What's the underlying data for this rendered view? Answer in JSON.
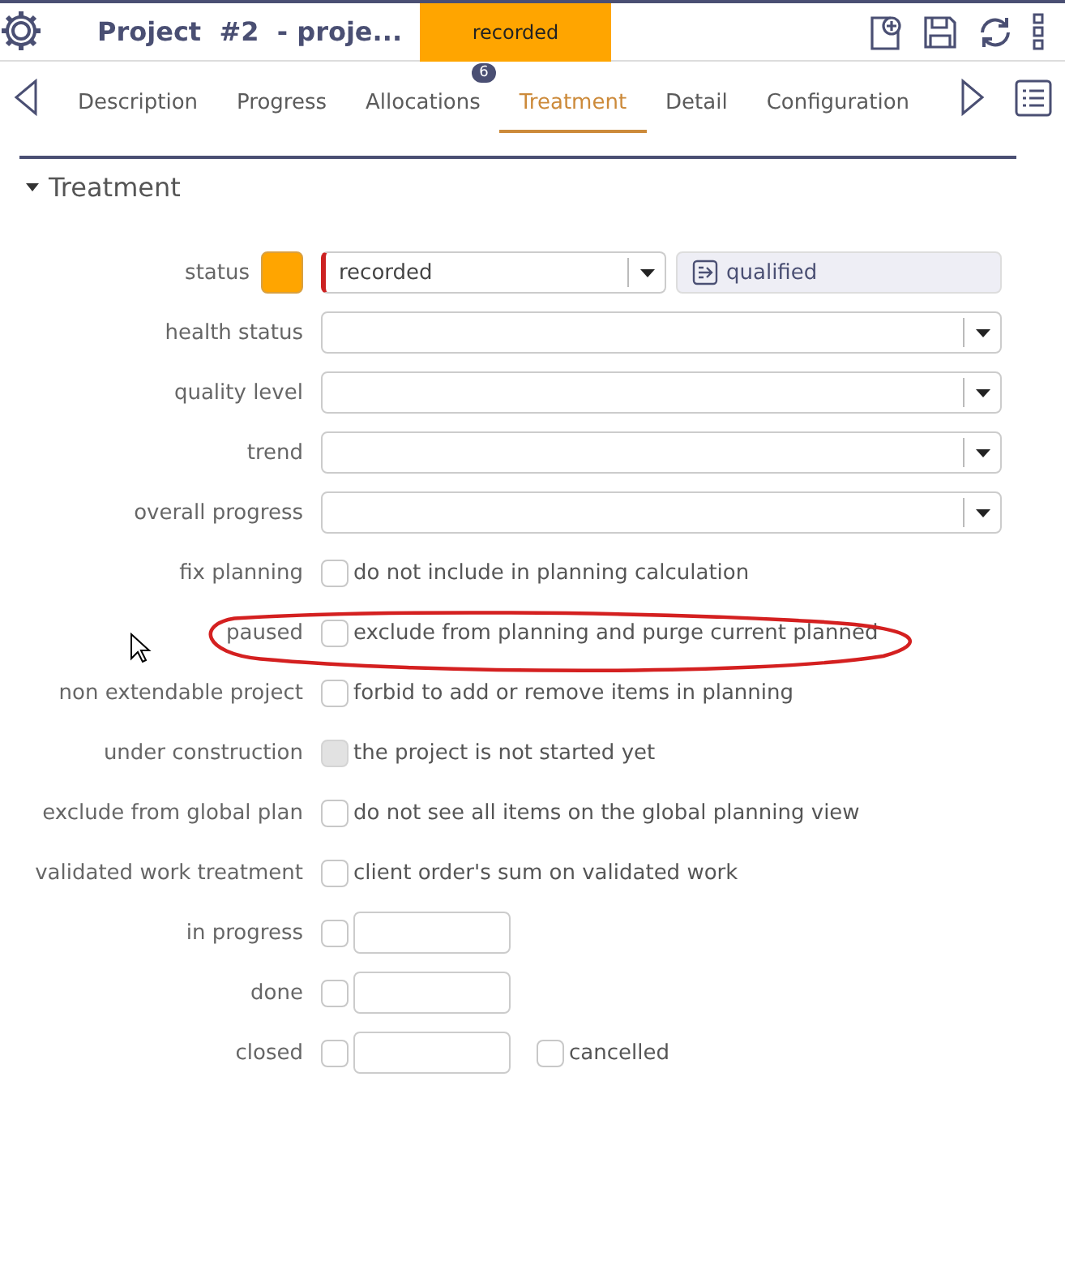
{
  "header": {
    "title": "Project  #2  - proje...",
    "status": "recorded"
  },
  "tabs": [
    {
      "label": "Description",
      "selected": false
    },
    {
      "label": "Progress",
      "selected": false
    },
    {
      "label": "Allocations",
      "selected": false,
      "badge": "6"
    },
    {
      "label": "Treatment",
      "selected": true
    },
    {
      "label": "Detail",
      "selected": false
    },
    {
      "label": "Configuration",
      "selected": false
    }
  ],
  "section": {
    "title": "Treatment",
    "expanded": true
  },
  "rows": [
    {
      "kind": "status",
      "label": "status",
      "value": "recorded",
      "action": "qualified"
    },
    {
      "kind": "select",
      "label": "health status"
    },
    {
      "kind": "select",
      "label": "quality level"
    },
    {
      "kind": "select",
      "label": "trend"
    },
    {
      "kind": "select",
      "label": "overall progress"
    },
    {
      "kind": "checkbox",
      "label": "fix planning",
      "text": "do not include in planning calculation",
      "checked": false,
      "disabled": false
    },
    {
      "kind": "checkbox",
      "label": "paused",
      "text": "exclude from planning and purge current planned",
      "checked": false,
      "disabled": false
    },
    {
      "kind": "checkbox",
      "label": "non extendable project",
      "text": "forbid to add or remove items in planning",
      "checked": false,
      "disabled": false
    },
    {
      "kind": "checkbox",
      "label": "under construction",
      "text": "the project is not started yet",
      "checked": false,
      "disabled": true
    },
    {
      "kind": "checkbox",
      "label": "exclude from global plan",
      "text": "do not see all items on the global planning view",
      "checked": false,
      "disabled": false
    },
    {
      "kind": "checkbox",
      "label": "validated work treatment",
      "text": "client order's sum on validated work",
      "checked": false,
      "disabled": false
    },
    {
      "kind": "date",
      "label": "in progress",
      "checked": false
    },
    {
      "kind": "date",
      "label": "done",
      "checked": false
    },
    {
      "kind": "date",
      "label": "closed",
      "checked": false,
      "extra": {
        "label": "cancelled",
        "checked": false
      }
    }
  ]
}
